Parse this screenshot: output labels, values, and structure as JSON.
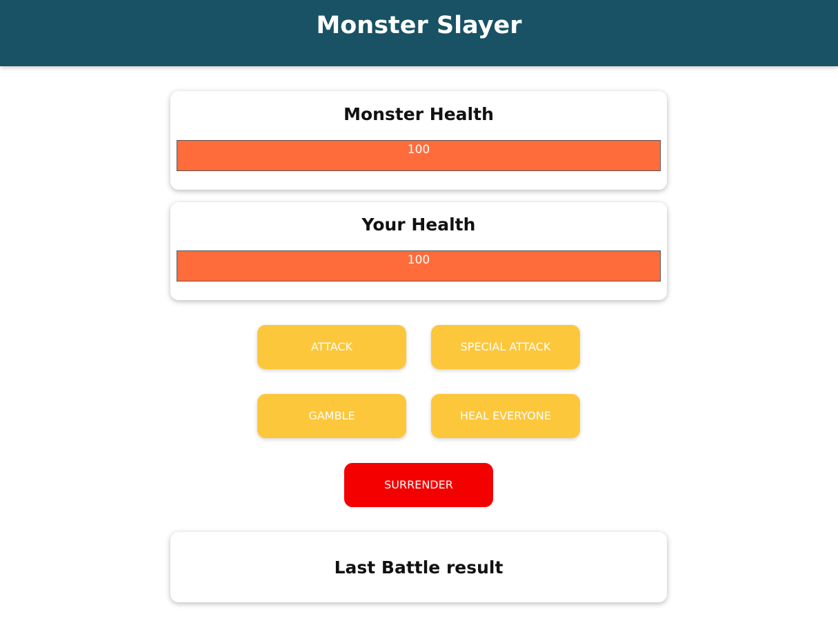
{
  "header": {
    "title": "Monster Slayer"
  },
  "monster": {
    "title": "Monster Health",
    "health": 100,
    "health_label": "100"
  },
  "player": {
    "title": "Your Health",
    "health": 100,
    "health_label": "100"
  },
  "actions": {
    "attack": "ATTACK",
    "special_attack": "SPECIAL ATTACK",
    "gamble": "GAMBLE",
    "heal_everyone": "HEAL EVERYONE",
    "surrender": "SURRENDER"
  },
  "log": {
    "title": "Last Battle result"
  },
  "colors": {
    "header_bg": "#185264",
    "health_fill": "#ff6c3b",
    "action_button": "#fdc73c",
    "surrender_button": "#f50000"
  }
}
